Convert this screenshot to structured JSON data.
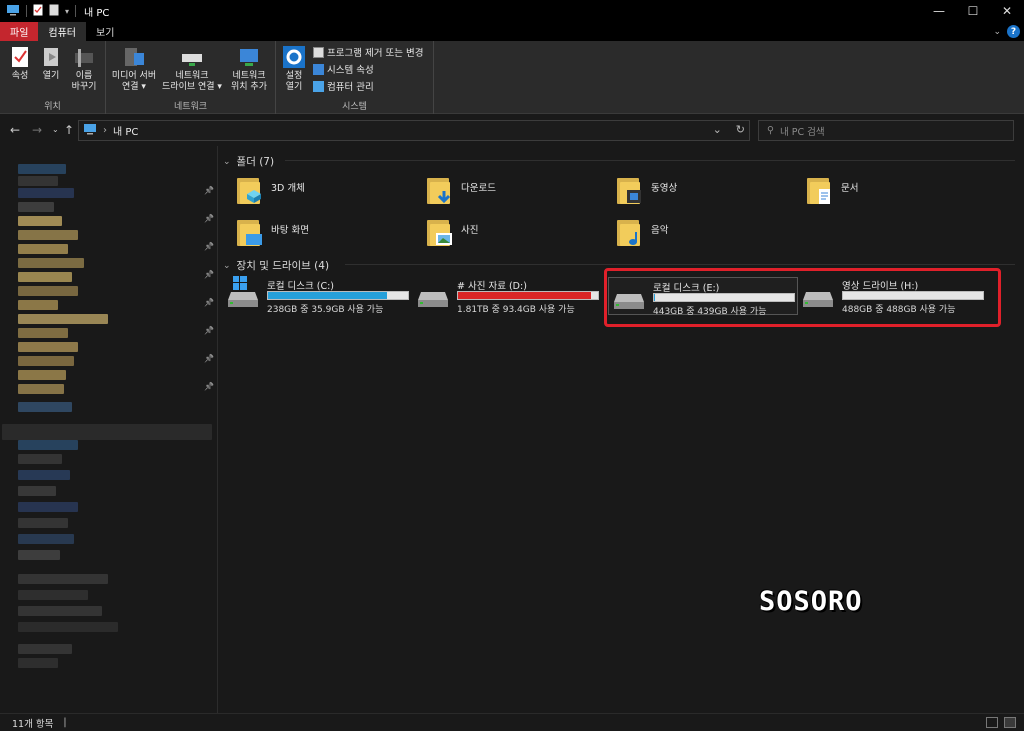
{
  "window": {
    "title": "내 PC",
    "controls": [
      "—",
      "☐",
      "✕"
    ]
  },
  "ribbon_tabs": {
    "file": "파일",
    "computer": "컴퓨터",
    "view": "보기"
  },
  "ribbon": {
    "location": {
      "properties": "속성",
      "open": "열기",
      "rename_1": "이름",
      "rename_2": "바꾸기",
      "group": "위치"
    },
    "network": {
      "media_1": "미디어 서버",
      "media_2": "연결 ▾",
      "map_1": "네트워크",
      "map_2": "드라이브 연결 ▾",
      "add_1": "네트워크",
      "add_2": "위치 추가",
      "group": "네트워크"
    },
    "system": {
      "settings_1": "설정",
      "settings_2": "열기",
      "uninstall": "프로그램 제거 또는 변경",
      "sys_props": "시스템 속성",
      "manage": "컴퓨터 관리",
      "group": "시스템"
    }
  },
  "address": {
    "path": "내 PC",
    "search_placeholder": "내 PC 검색"
  },
  "folders": {
    "heading": "폴더 (7)",
    "items": [
      "3D 개체",
      "다운로드",
      "동영상",
      "문서",
      "바탕 화면",
      "사진",
      "음악"
    ]
  },
  "drives": {
    "heading": "장치 및 드라이브 (4)",
    "items": [
      {
        "name": "로컬 디스크 (C:)",
        "info": "238GB 중 35.9GB 사용 가능",
        "used_fraction": 0.85,
        "color": "#26a0da"
      },
      {
        "name": "# 사진 자료 (D:)",
        "info": "1.81TB 중 93.4GB 사용 가능",
        "used_fraction": 0.95,
        "color": "#da2626"
      },
      {
        "name": "로컬 디스크 (E:)",
        "info": "443GB 중 439GB 사용 가능",
        "used_fraction": 0.01,
        "color": "#26a0da"
      },
      {
        "name": "영상 드라이브 (H:)",
        "info": "488GB 중 488GB 사용 가능",
        "used_fraction": 0.0,
        "color": "#26a0da"
      }
    ]
  },
  "watermark": "SOSORO",
  "status": {
    "count": "11개 항목"
  }
}
